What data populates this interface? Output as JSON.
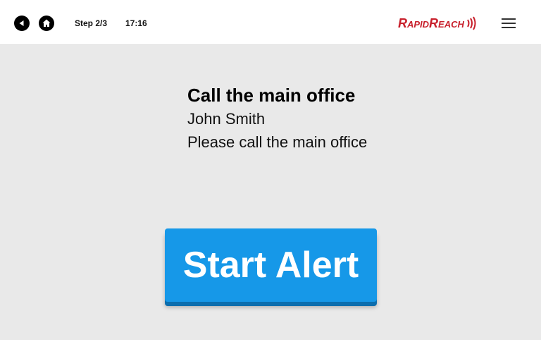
{
  "header": {
    "step": "Step 2/3",
    "time": "17:16",
    "brand": "RapidReach",
    "icons": {
      "back": "back-arrow-icon",
      "home": "home-icon",
      "menu": "hamburger-menu-icon",
      "brand_signal": "signal-waves-icon"
    }
  },
  "message": {
    "title": "Call the main office",
    "sender": "John Smith",
    "body": "Please call the main office"
  },
  "action": {
    "start_label": "Start Alert"
  },
  "colors": {
    "brand_red": "#c8202c",
    "button_blue": "#1698e8",
    "background": "#e9e9e9"
  }
}
